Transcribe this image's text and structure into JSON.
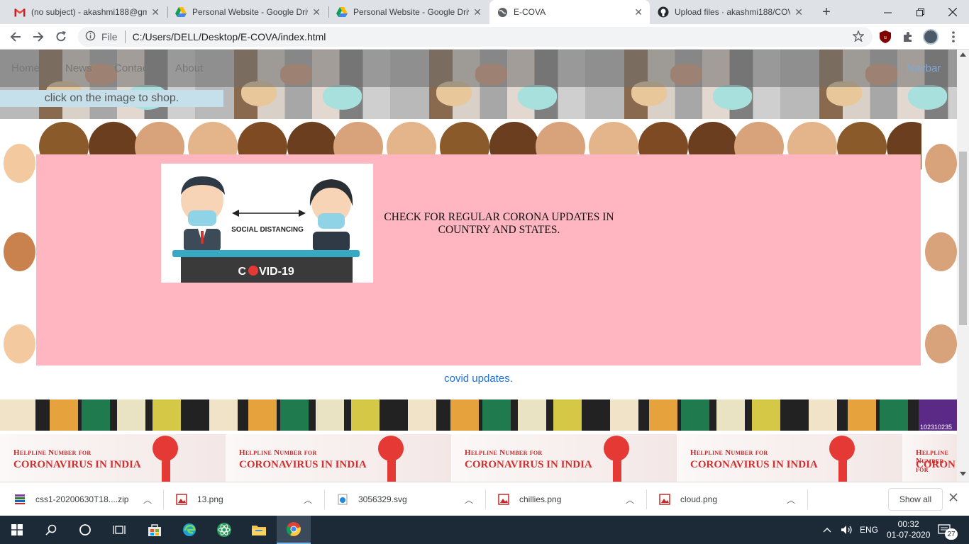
{
  "browser": {
    "tabs": [
      {
        "title": "(no subject) - akashmi188@gm",
        "icon": "gmail-icon"
      },
      {
        "title": "Personal Website - Google Driv",
        "icon": "google-drive-icon"
      },
      {
        "title": "Personal Website - Google Driv",
        "icon": "google-drive-icon"
      },
      {
        "title": "E-COVA",
        "icon": "globe-icon",
        "active": true
      },
      {
        "title": "Upload files · akashmi188/COV",
        "icon": "github-icon"
      }
    ],
    "new_tab_symbol": "+",
    "address": {
      "scheme_label": "File",
      "url": "C:/Users/DELL/Desktop/E-COVA/index.html"
    }
  },
  "page": {
    "nav": {
      "items": [
        "Home",
        "News",
        "Contact",
        "About"
      ],
      "right_item": "Navbar"
    },
    "shop_note": "click on the image to shop.",
    "card": {
      "image_caption": "SOCIAL DISTANCING",
      "image_title_prefix": "C",
      "image_title_suffix": "VID-19",
      "text": "CHECK FOR REGULAR CORONA UPDATES IN COUNTRY AND STATES.",
      "background": "#ffb6c1",
      "link": "covid updates."
    },
    "watermark_id": "102310235",
    "helpline": {
      "line1": "Helpline Number for",
      "line2": "CORONAVIRUS IN INDIA",
      "line2_cut": "CORON"
    }
  },
  "downloads": {
    "items": [
      {
        "name": "css1-20200630T18....zip",
        "icon": "zip-icon"
      },
      {
        "name": "13.png",
        "icon": "image-icon"
      },
      {
        "name": "3056329.svg",
        "icon": "edge-file-icon"
      },
      {
        "name": "chillies.png",
        "icon": "image-icon"
      },
      {
        "name": "cloud.png",
        "icon": "image-icon"
      }
    ],
    "show_all": "Show all"
  },
  "taskbar": {
    "language": "ENG",
    "time": "00:32",
    "date": "01-07-2020",
    "notifications": "27"
  }
}
